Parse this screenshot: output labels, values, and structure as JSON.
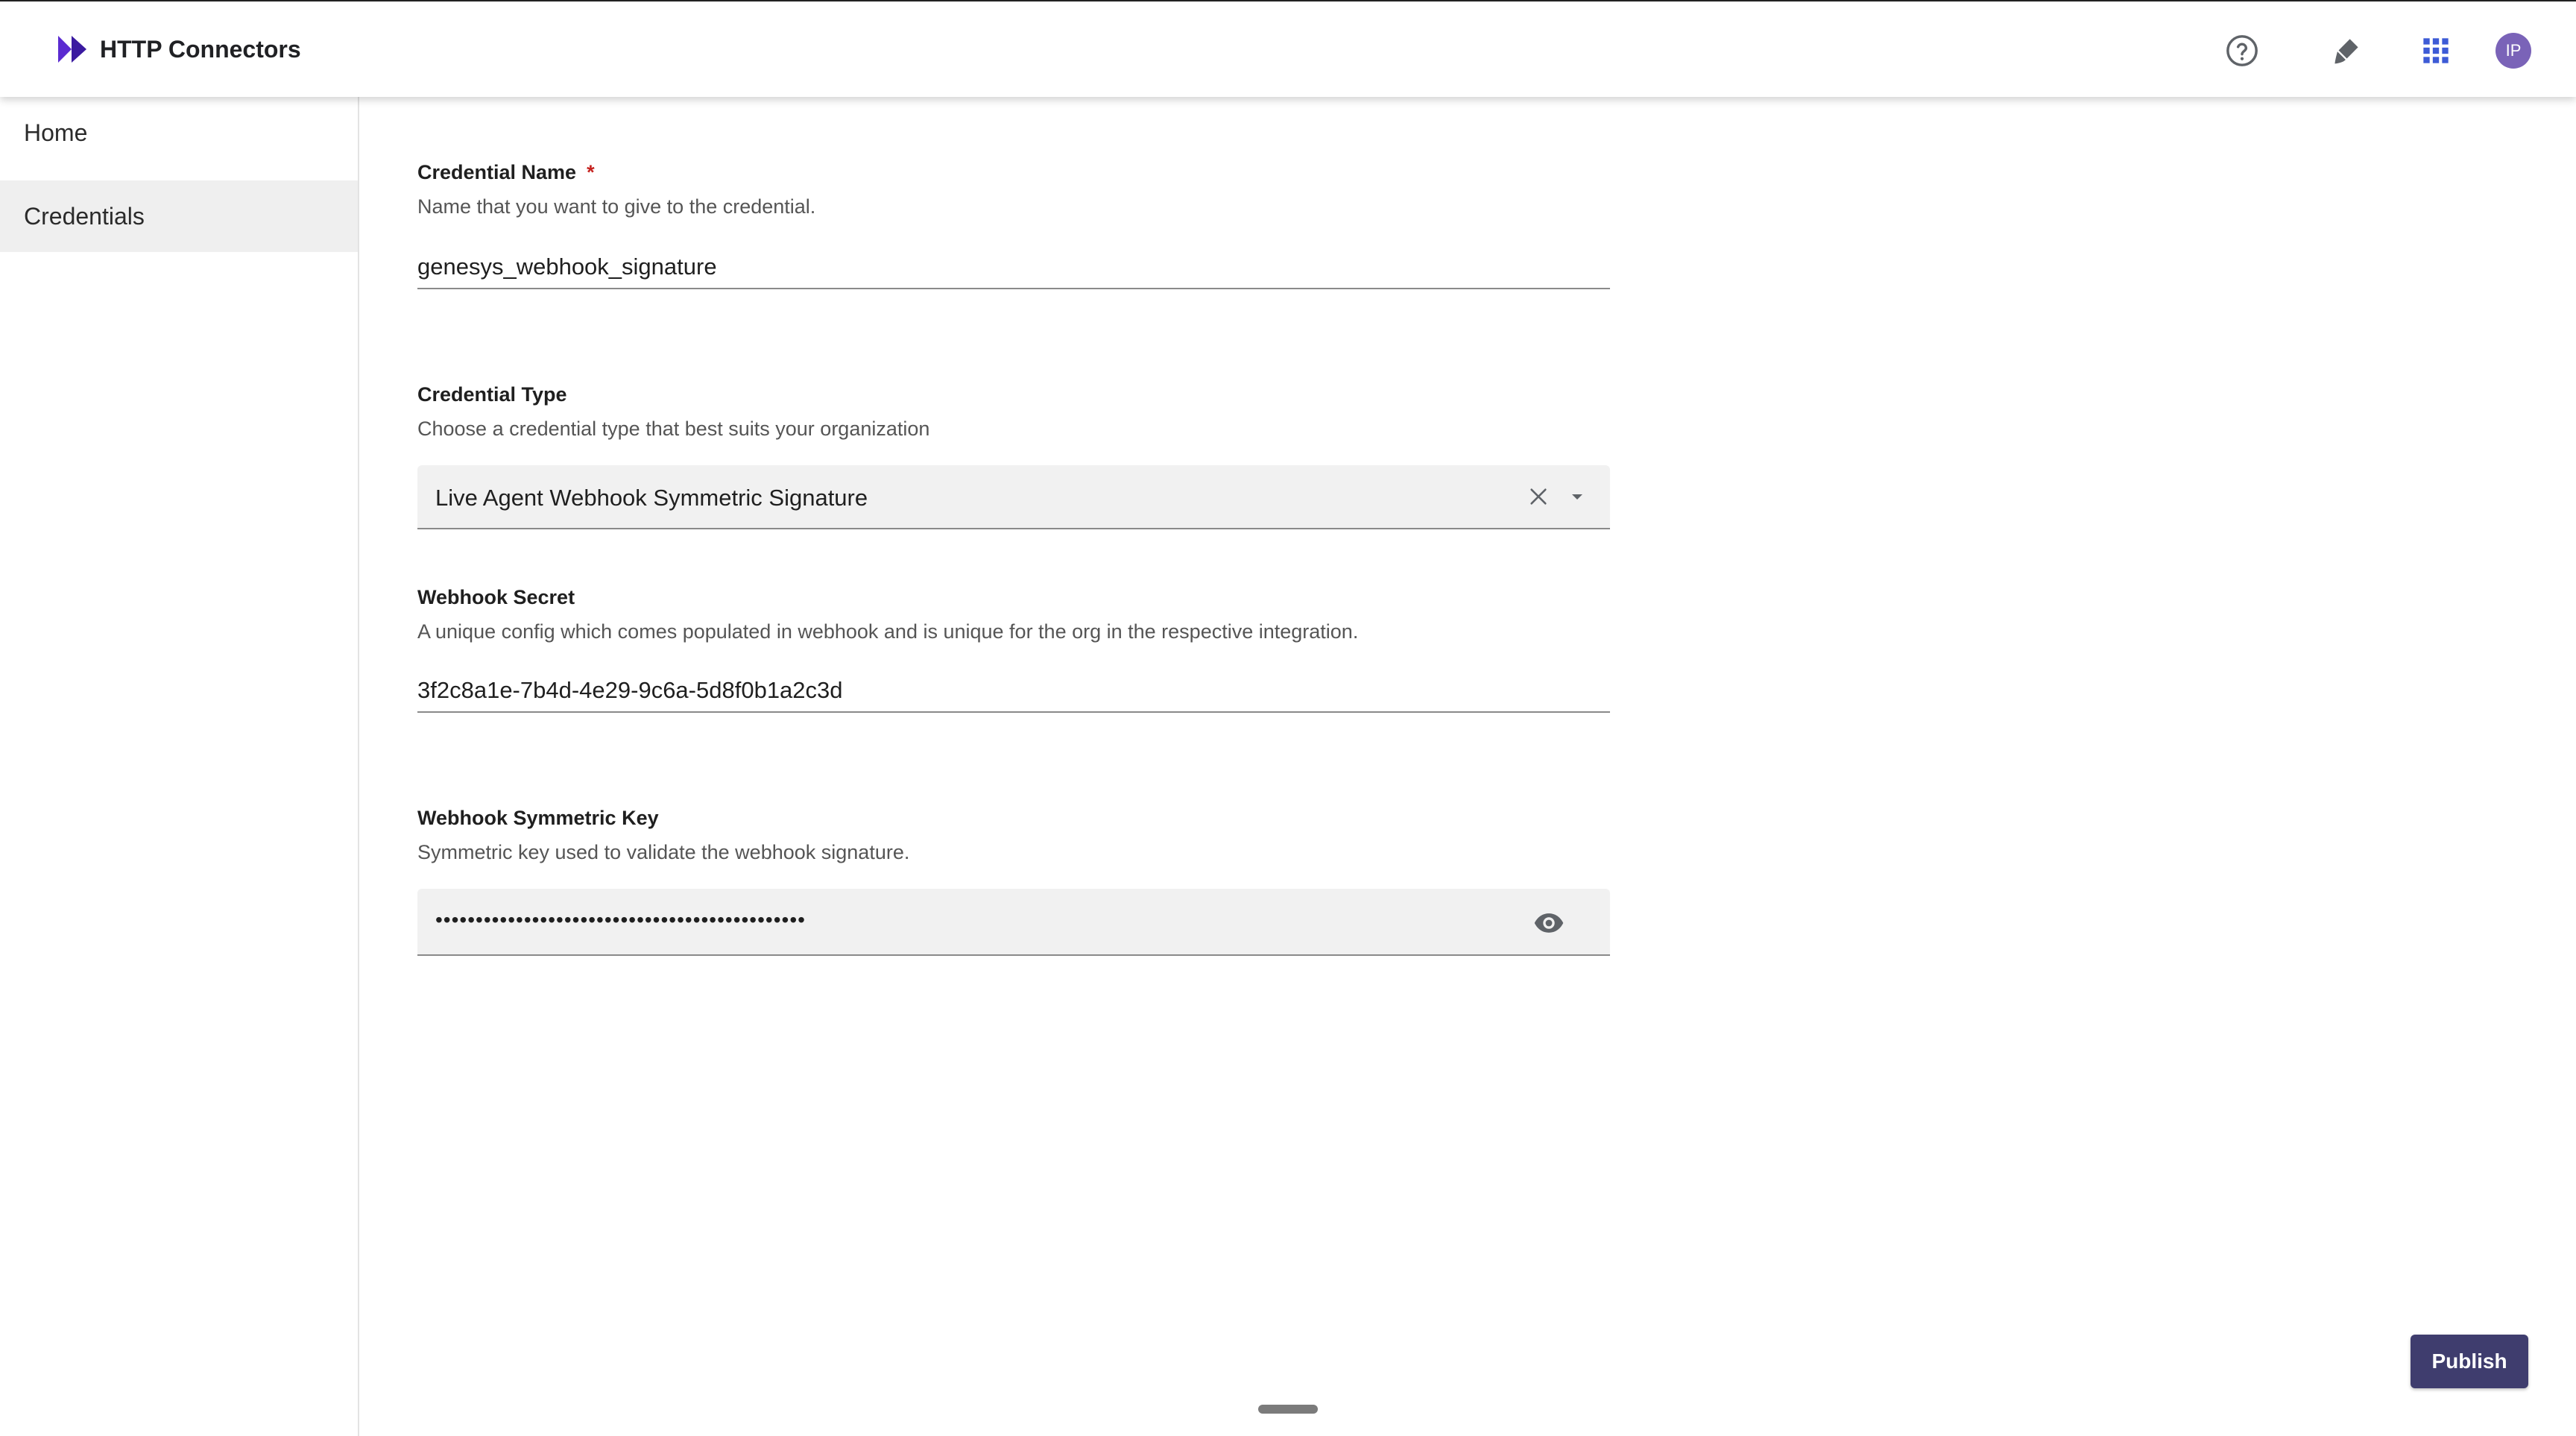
{
  "app": {
    "title": "HTTP Connectors",
    "accent_color": "#5b2bd1"
  },
  "header": {
    "icons": [
      "help-icon",
      "paint-brush-icon",
      "apps-grid-icon"
    ],
    "avatar_initials": "IP",
    "avatar_color": "#7a63b8"
  },
  "sidebar": {
    "items": [
      {
        "label": "Home",
        "active": false
      },
      {
        "label": "Credentials",
        "active": true
      }
    ]
  },
  "form": {
    "credential_name": {
      "label": "Credential Name",
      "required_mark": "*",
      "help": "Name that you want to give to the credential.",
      "value": "genesys_webhook_signature"
    },
    "credential_type": {
      "label": "Credential Type",
      "help": "Choose a credential type that best suits your organization",
      "value": "Live Agent Webhook Symmetric Signature"
    },
    "webhook_secret": {
      "label": "Webhook Secret",
      "help": "A unique config which comes populated in webhook and is unique for the org in the respective integration.",
      "value": "3f2c8a1e-7b4d-4e29-9c6a-5d8f0b1a2c3d"
    },
    "webhook_symmetric_key": {
      "label": "Webhook Symmetric Key",
      "help": "Symmetric key used to validate the webhook signature.",
      "masked_value": "••••••••••••••••••••••••••••••••••••••••••••••"
    }
  },
  "actions": {
    "publish_label": "Publish",
    "publish_color": "#3f3d6e"
  }
}
